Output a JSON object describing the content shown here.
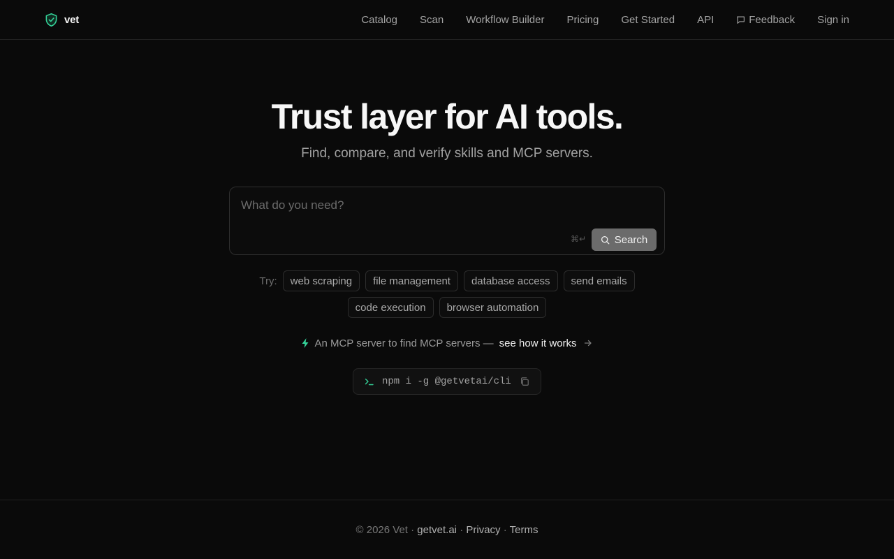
{
  "header": {
    "brand": {
      "name": "vet",
      "icon": "shield-check-icon",
      "accent": "#34d399"
    },
    "nav": [
      {
        "label": "Catalog"
      },
      {
        "label": "Scan"
      },
      {
        "label": "Workflow Builder"
      },
      {
        "label": "Pricing"
      },
      {
        "label": "Get Started"
      },
      {
        "label": "API"
      },
      {
        "label": "Feedback",
        "icon": "message-square-icon"
      },
      {
        "label": "Sign in"
      }
    ]
  },
  "hero": {
    "title": "Trust layer for AI tools.",
    "subtitle": "Find, compare, and verify skills and MCP servers."
  },
  "search": {
    "placeholder": "What do you need?",
    "value": "",
    "shortcut": "⌘↵",
    "button_label": "Search",
    "button_icon": "search-icon"
  },
  "suggestions": {
    "label": "Try:",
    "chips": [
      "web scraping",
      "file management",
      "database access",
      "send emails",
      "code execution",
      "browser automation"
    ]
  },
  "promo": {
    "icon": "bolt-icon",
    "text": "An MCP server to find MCP servers —",
    "link_label": "see how it works",
    "link_icon": "arrow-right-icon"
  },
  "install": {
    "prompt": "›_",
    "command": "npm i -g @getvetai/cli",
    "copy_icon": "copy-icon"
  },
  "footer": {
    "copyright": "© 2026 Vet ·",
    "site": "getvet.ai",
    "sep1": "·",
    "privacy": "Privacy",
    "sep2": "·",
    "terms": "Terms"
  },
  "colors": {
    "background": "#0a0a0a",
    "accent": "#34d399",
    "button": "#6b6b6b"
  }
}
